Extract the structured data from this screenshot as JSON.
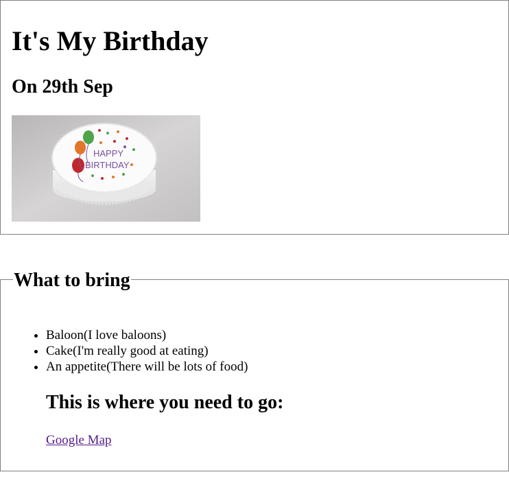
{
  "header": {
    "title": "It's My Birthday",
    "date_line": "On 29th Sep",
    "image_text": [
      "HAPPY",
      "BIRTHDAY"
    ]
  },
  "bring": {
    "legend": "What to bring",
    "items": [
      "Baloon(I love baloons)",
      "Cake(I'm really good at eating)",
      "An appetite(There will be lots of food)"
    ]
  },
  "directions": {
    "heading": "This is where you need to go:",
    "link_text": "Google Map"
  },
  "colors": {
    "border": "#808080",
    "visited_link": "#551a8b"
  }
}
